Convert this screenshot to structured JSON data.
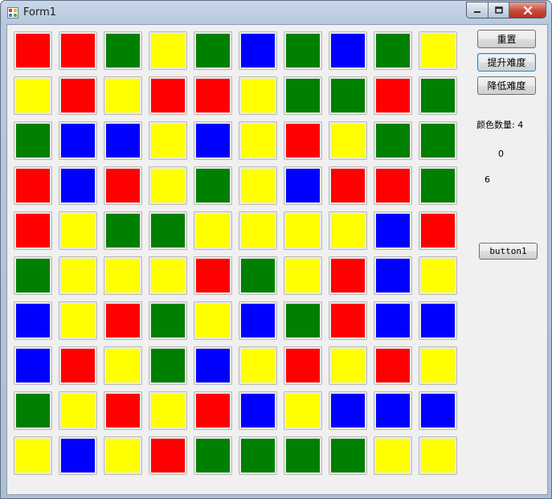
{
  "window": {
    "title": "Form1"
  },
  "colors": {
    "red": "#ff0000",
    "green": "#008000",
    "blue": "#0000ff",
    "yellow": "#ffff00"
  },
  "grid": {
    "rows": 10,
    "cols": 10,
    "cells": [
      [
        "red",
        "red",
        "green",
        "yellow",
        "green",
        "blue",
        "green",
        "blue",
        "green",
        "yellow"
      ],
      [
        "yellow",
        "red",
        "yellow",
        "red",
        "red",
        "yellow",
        "green",
        "green",
        "red",
        "green"
      ],
      [
        "green",
        "blue",
        "blue",
        "yellow",
        "blue",
        "yellow",
        "red",
        "yellow",
        "green",
        "green"
      ],
      [
        "red",
        "blue",
        "red",
        "yellow",
        "green",
        "yellow",
        "blue",
        "red",
        "red",
        "green"
      ],
      [
        "red",
        "yellow",
        "green",
        "green",
        "yellow",
        "yellow",
        "yellow",
        "yellow",
        "blue",
        "red"
      ],
      [
        "green",
        "yellow",
        "yellow",
        "yellow",
        "red",
        "green",
        "yellow",
        "red",
        "blue",
        "yellow"
      ],
      [
        "blue",
        "yellow",
        "red",
        "green",
        "yellow",
        "blue",
        "green",
        "red",
        "blue",
        "blue"
      ],
      [
        "blue",
        "red",
        "yellow",
        "green",
        "blue",
        "yellow",
        "red",
        "yellow",
        "red",
        "yellow"
      ],
      [
        "green",
        "yellow",
        "red",
        "yellow",
        "red",
        "blue",
        "yellow",
        "blue",
        "blue",
        "blue"
      ],
      [
        "yellow",
        "blue",
        "yellow",
        "red",
        "green",
        "green",
        "green",
        "green",
        "yellow",
        "yellow"
      ]
    ]
  },
  "controls": {
    "reset_label": "重置",
    "harder_label": "提升难度",
    "easier_label": "降低难度",
    "color_count_label": "颜色数量: 4",
    "value_1": "0",
    "value_2": "6",
    "button1_label": "button1"
  }
}
